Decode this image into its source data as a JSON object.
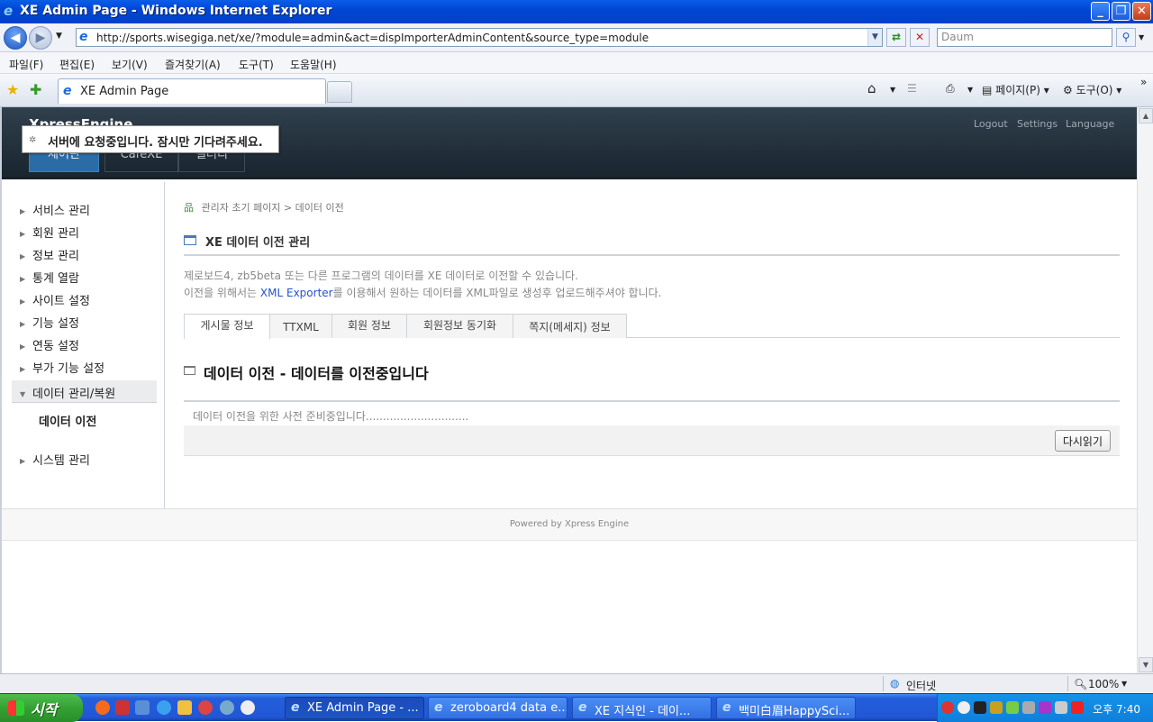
{
  "window": {
    "title": "XE Admin Page - Windows Internet Explorer"
  },
  "address": {
    "url": "http://sports.wisegiga.net/xe/?module=admin&act=dispImporterAdminContent&source_type=module",
    "search_placeholder": "Daum"
  },
  "menubar": [
    "파일(F)",
    "편집(E)",
    "보기(V)",
    "즐겨찾기(A)",
    "도구(T)",
    "도움말(H)"
  ],
  "tabbar": {
    "tab_title": "XE Admin Page",
    "page_label": "페이지(P)",
    "tools_label": "도구(O)"
  },
  "xe": {
    "logo": "XpressEngine",
    "header_links": [
      "Logout",
      "Settings",
      "Language"
    ],
    "tabs": [
      "제어판",
      "CafeXE",
      "갤러리"
    ],
    "toast": "서버에 요청중입니다. 잠시만 기다려주세요."
  },
  "sidebar": {
    "items": [
      "서비스 관리",
      "회원 관리",
      "정보 관리",
      "통계 열람",
      "사이트 설정",
      "기능 설정",
      "연동 설정",
      "부가 기능 설정"
    ],
    "active": "데이터 관리/복원",
    "sub": "데이터 이전",
    "last": "시스템 관리"
  },
  "main": {
    "breadcrumb_root": "관리자 초기 페이지",
    "breadcrumb_sep": ">",
    "breadcrumb_current": "데이터 이전",
    "title": "XE 데이터 이전 관리",
    "desc1": "제로보드4, zb5beta 또는 다른 프로그램의 데이터를 XE 데이터로 이전할 수 있습니다.",
    "desc2_pre": "이전을 위해서는 ",
    "desc2_link": "XML Exporter",
    "desc2_post": "를 이용해서 원하는 데이터를 XML파일로 생성후 업로드해주셔야 합니다.",
    "tabs": [
      "게시물 정보",
      "TTXML",
      "회원 정보",
      "회원정보 동기화",
      "쪽지(메세지) 정보"
    ],
    "section_title": "데이터 이전 - 데이터를 이전중입니다",
    "progress_text": "데이터 이전을 위한 사전 준비중입니다..............................",
    "reload_label": "다시읽기",
    "footer": "Powered by Xpress Engine"
  },
  "statusbar": {
    "zone": "인터넷",
    "zoom": "100%"
  },
  "taskbar": {
    "start": "시작",
    "tasks": [
      "XE Admin Page - ...",
      "zeroboard4 data e...",
      "XE 지식인 - 데이...",
      "백미白眉HappySci..."
    ],
    "clock": "오후 7:40"
  }
}
